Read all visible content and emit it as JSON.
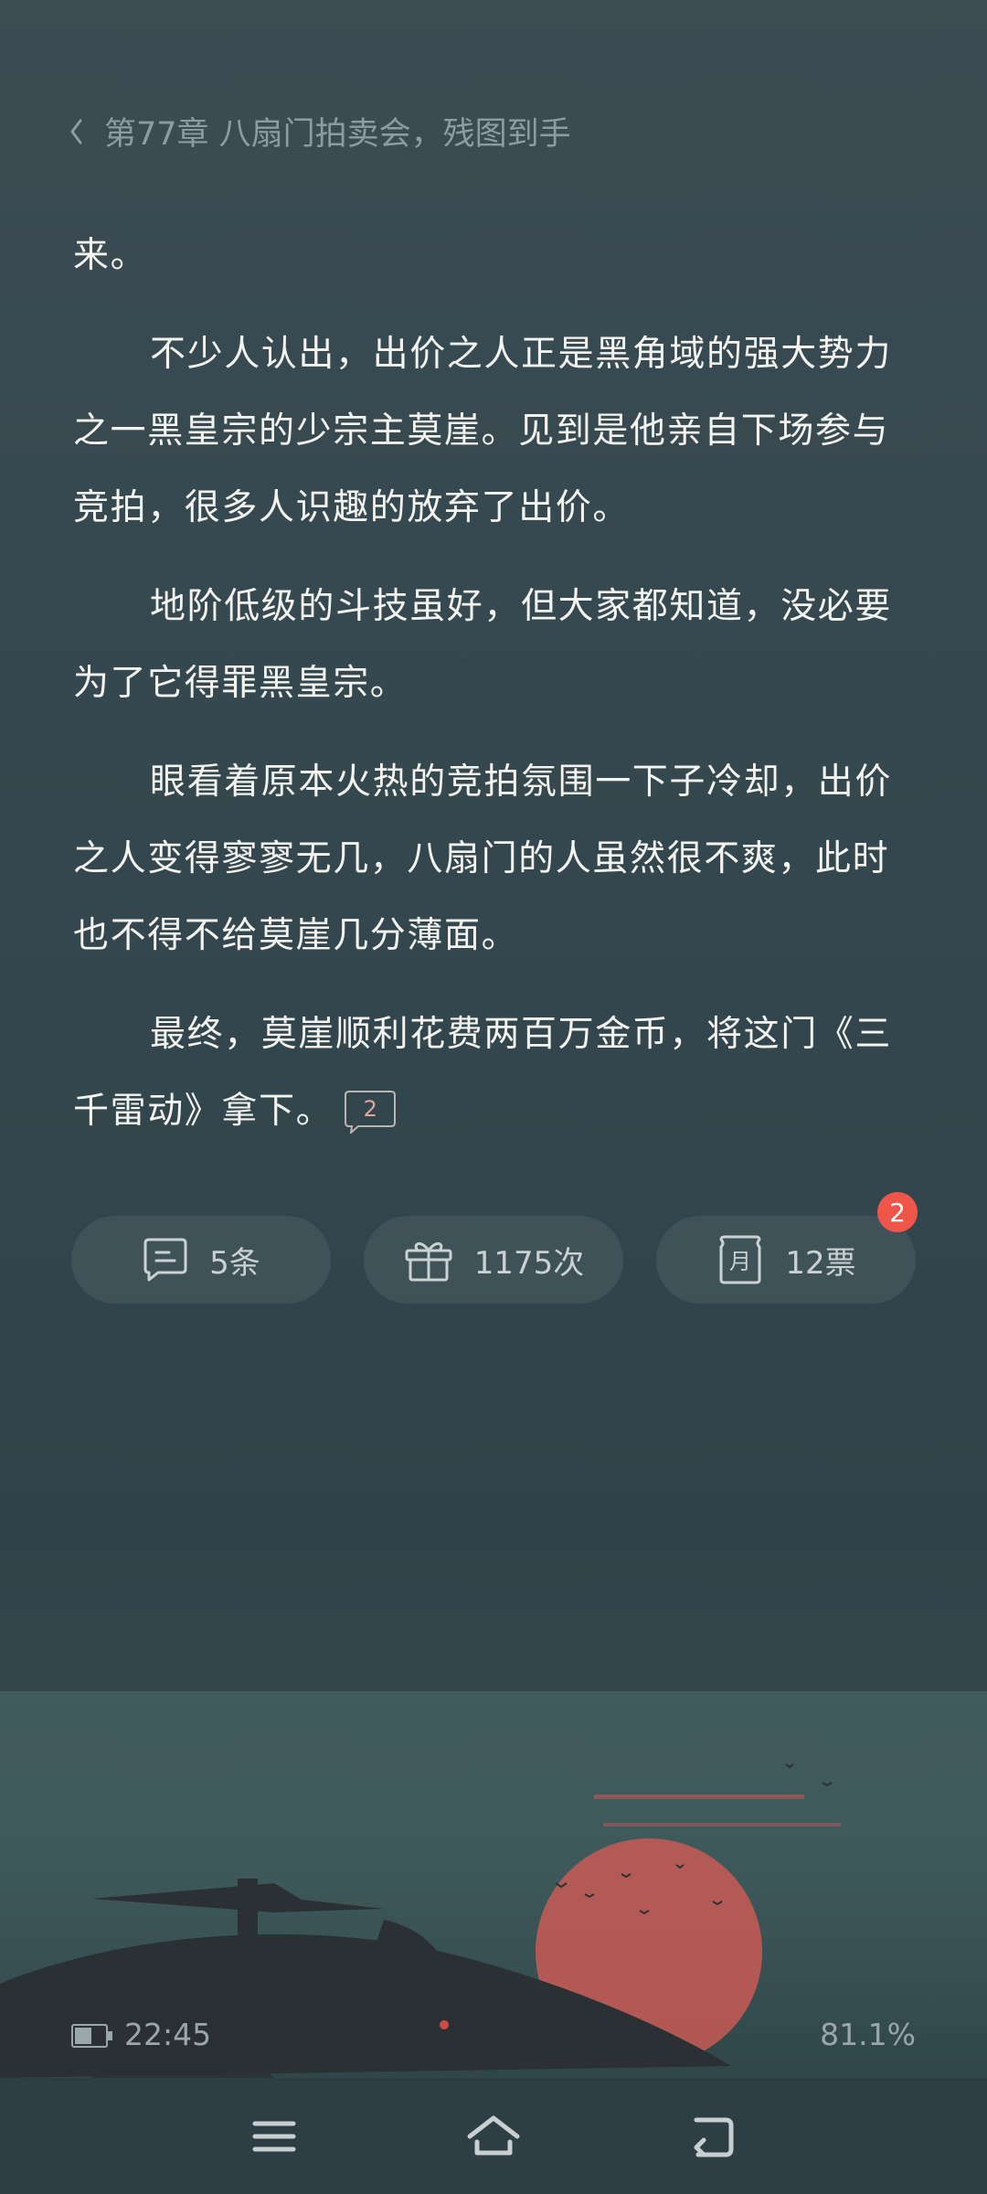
{
  "header": {
    "chapter_title": "第77章 八扇门拍卖会，残图到手"
  },
  "content": {
    "paragraphs": [
      "来。",
      "不少人认出，出价之人正是黑角域的强大势力之一黑皇宗的少宗主莫崖。见到是他亲自下场参与竞拍，很多人识趣的放弃了出价。",
      "地阶低级的斗技虽好，但大家都知道，没必要为了它得罪黑皇宗。",
      "眼看着原本火热的竞拍氛围一下子冷却，出价之人变得寥寥无几，八扇门的人虽然很不爽，此时也不得不给莫崖几分薄面。",
      "最终，莫崖顺利花费两百万金币，将这门《三千雷动》拿下。"
    ],
    "paragraph_comment_count": "2"
  },
  "actions": {
    "comments_label": "5条",
    "gifts_label": "1175次",
    "monthly_votes_label": "12票",
    "monthly_votes_badge": "2"
  },
  "status": {
    "time": "22:45",
    "reading_progress": "81.1%"
  },
  "colors": {
    "background": "#34474e",
    "text": "#f3f3ef",
    "header_text": "#8d9ca0",
    "badge": "#f0554a",
    "sun": "#c95a56"
  },
  "icons": {
    "header": "chevron-left-icon",
    "comments": "comment-icon",
    "gifts": "gift-icon",
    "votes": "monthly-ticket-icon",
    "battery": "battery-icon",
    "nav_menu": "menu-icon",
    "nav_home": "home-icon",
    "nav_back": "back-icon"
  }
}
